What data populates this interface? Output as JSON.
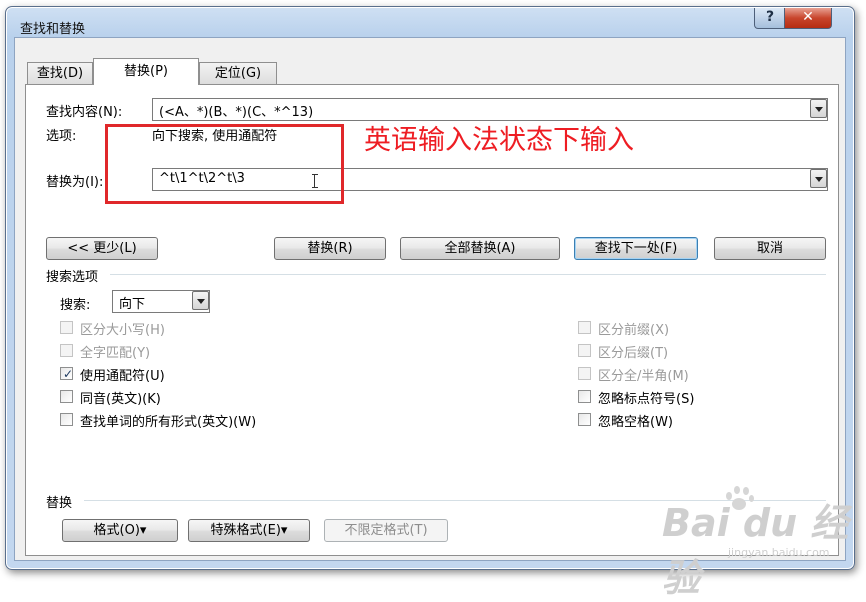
{
  "window": {
    "title": "查找和替换",
    "help_label": "?",
    "close_label": "✕"
  },
  "tabs": [
    {
      "label": "查找(D)"
    },
    {
      "label": "替换(P)"
    },
    {
      "label": "定位(G)"
    }
  ],
  "find": {
    "label": "查找内容(N):",
    "value": "(<A、*)(B、*)(C、*^13)"
  },
  "options": {
    "label": "选项:",
    "value": "向下搜索, 使用通配符"
  },
  "replace": {
    "label": "替换为(I):",
    "value": "^t\\1^t\\2^t\\3"
  },
  "buttons": {
    "less": "<< 更少(L)",
    "replace": "替换(R)",
    "replace_all": "全部替换(A)",
    "find_next": "查找下一处(F)",
    "cancel": "取消"
  },
  "search_options": {
    "section_label": "搜索选项",
    "direction_label": "搜索:",
    "direction_value": "向下",
    "left": [
      {
        "label": "区分大小写(H)",
        "checked": false,
        "disabled": true
      },
      {
        "label": "全字匹配(Y)",
        "checked": false,
        "disabled": true
      },
      {
        "label": "使用通配符(U)",
        "checked": true,
        "disabled": false
      },
      {
        "label": "同音(英文)(K)",
        "checked": false,
        "disabled": false
      },
      {
        "label": "查找单词的所有形式(英文)(W)",
        "checked": false,
        "disabled": false
      }
    ],
    "right": [
      {
        "label": "区分前缀(X)",
        "checked": false,
        "disabled": true
      },
      {
        "label": "区分后缀(T)",
        "checked": false,
        "disabled": true
      },
      {
        "label": "区分全/半角(M)",
        "checked": false,
        "disabled": true
      },
      {
        "label": "忽略标点符号(S)",
        "checked": false,
        "disabled": false
      },
      {
        "label": "忽略空格(W)",
        "checked": false,
        "disabled": false
      }
    ]
  },
  "replace_section": {
    "label": "替换",
    "format": "格式(O)▾",
    "special": "特殊格式(E)▾",
    "no_format": "不限定格式(T)"
  },
  "annotation": {
    "text": "英语输入法状态下输入",
    "color": "#ee1d23"
  },
  "watermark": {
    "brand": "Bai du 经验",
    "url": "jingyan.baidu.com"
  }
}
